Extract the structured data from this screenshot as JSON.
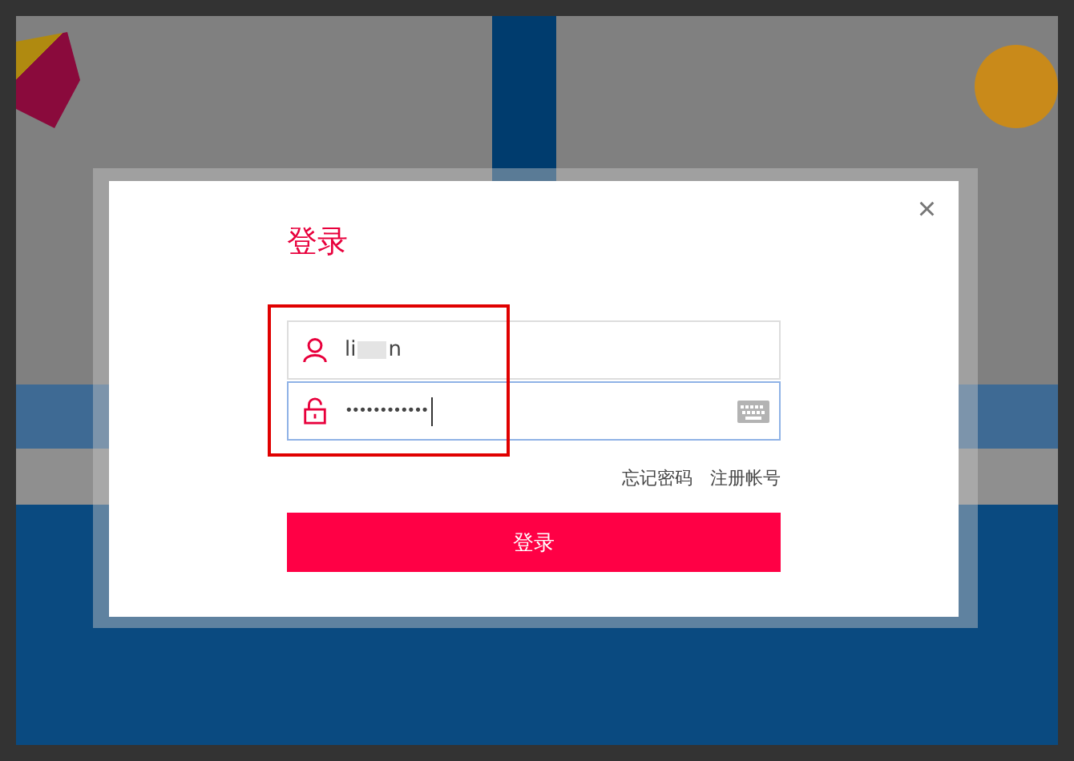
{
  "dialog": {
    "title": "登录",
    "close": "×"
  },
  "username": {
    "value_start": "li",
    "value_end": "n",
    "redacted": true
  },
  "password": {
    "masked": "••••••••••••",
    "focused": true
  },
  "links": [
    {
      "label": "忘记密码"
    },
    {
      "label": "注册帐号"
    }
  ],
  "submit": {
    "label": "登录"
  }
}
